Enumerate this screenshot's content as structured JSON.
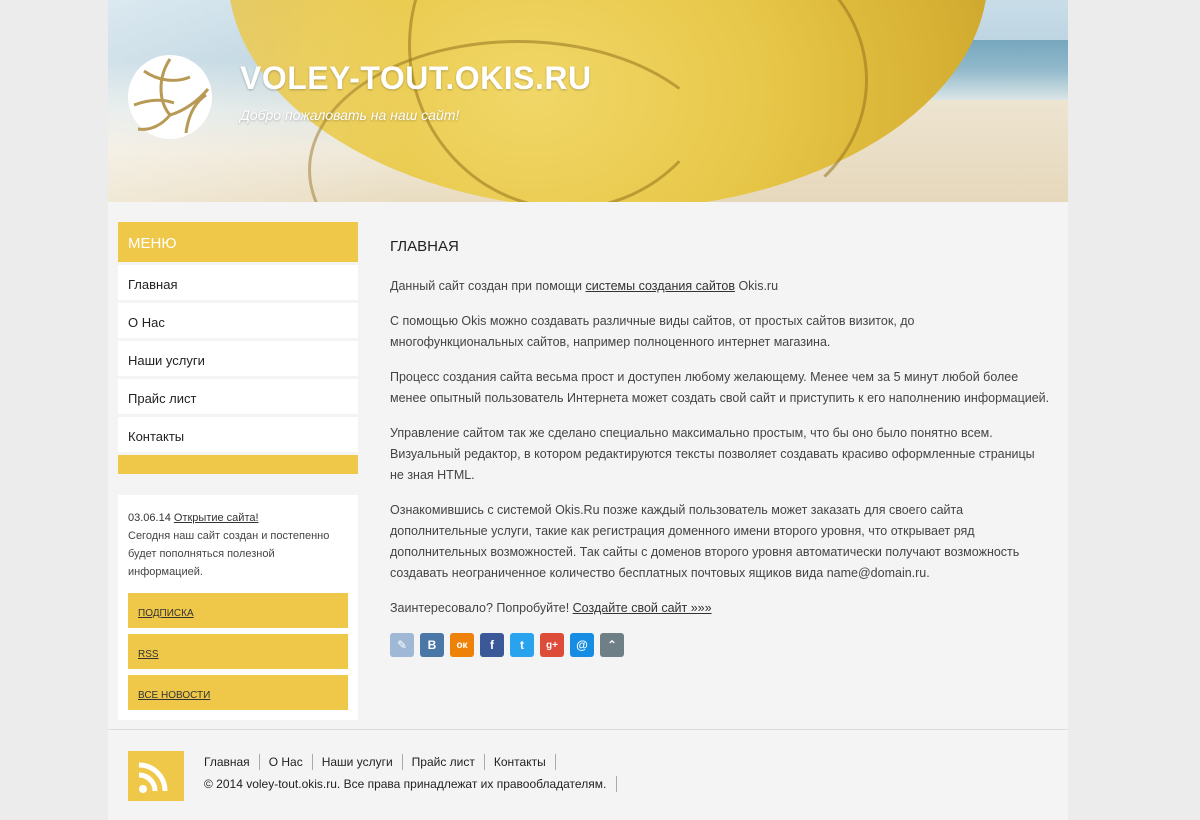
{
  "header": {
    "title": "VOLEY-TOUT.OKIS.RU",
    "slogan": "Добро пожаловать на наш сайт!",
    "logo_icon": "volleyball-icon"
  },
  "sidebar": {
    "menu_title": "МЕНЮ",
    "items": [
      {
        "label": "Главная"
      },
      {
        "label": "О Нас"
      },
      {
        "label": "Наши услуги"
      },
      {
        "label": "Прайс лист"
      },
      {
        "label": "Контакты"
      }
    ],
    "news": {
      "date": "03.06.14",
      "link": "Открытие сайта!",
      "text": "Сегодня наш сайт создан и постепенно будет пополняться полезной информацией."
    },
    "buttons": [
      {
        "label": "ПОДПИСКА"
      },
      {
        "label": "RSS"
      },
      {
        "label": "ВСЕ НОВОСТИ"
      }
    ]
  },
  "content": {
    "heading": "ГЛАВНАЯ",
    "p1_before": "Данный сайт создан при помощи ",
    "p1_link": "системы создания сайтов",
    "p1_after": " Okis.ru",
    "p2": "С помощью Okis можно создавать различные виды сайтов, от простых сайтов визиток, до многофункциональных сайтов, например полноценного интернет магазина.",
    "p3": "Процесс создания сайта весьма прост и доступен любому желающему. Менее чем за 5 минут любой более менее опытный пользователь Интернета может создать свой сайт и приступить к его наполнению информацией.",
    "p4": "Управление сайтом так же сделано специально максимально простым, что бы оно было понятно всем. Визуальный редактор, в котором редактируются тексты позволяет создавать красиво оформленные страницы не зная HTML.",
    "p5": "Ознакомившись с системой Okis.Ru позже каждый пользователь может заказать для своего сайта дополнительные услуги, такие как регистрация доменного имени второго уровня, что открывает ряд дополнительных возможностей. Так сайты с доменов второго уровня автоматически получают возможность создавать неограниченное количество бесплатных почтовых ящиков вида name@domain.ru.",
    "p6_before": "Заинтересовало? Попробуйте! ",
    "p6_link": "Создайте свой сайт »»»",
    "share": [
      {
        "icon": "livejournal-icon",
        "glyph": "✎",
        "color": "#9fb8d6"
      },
      {
        "icon": "vkontakte-icon",
        "glyph": "B",
        "color": "#4a76a8"
      },
      {
        "icon": "odnoklassniki-icon",
        "glyph": "ок",
        "color": "#ee8208"
      },
      {
        "icon": "facebook-icon",
        "glyph": "f",
        "color": "#3b5998"
      },
      {
        "icon": "twitter-icon",
        "glyph": "t",
        "color": "#2aa3ef"
      },
      {
        "icon": "googleplus-icon",
        "glyph": "g+",
        "color": "#dd4b39"
      },
      {
        "icon": "mailru-icon",
        "glyph": "@",
        "color": "#168de2"
      },
      {
        "icon": "more-icon",
        "glyph": "⌃",
        "color": "#6f7f86"
      }
    ]
  },
  "footer": {
    "nav": [
      {
        "label": "Главная"
      },
      {
        "label": "О Нас"
      },
      {
        "label": "Наши услуги"
      },
      {
        "label": "Прайс лист"
      },
      {
        "label": "Контакты"
      }
    ],
    "copyright": "© 2014 voley-tout.okis.ru. Все права принадлежат их правообладателям.",
    "rss_icon": "rss-icon"
  },
  "colors": {
    "accent": "#efc84a",
    "page_bg": "#f4f4f4",
    "body_bg": "#ececec"
  }
}
